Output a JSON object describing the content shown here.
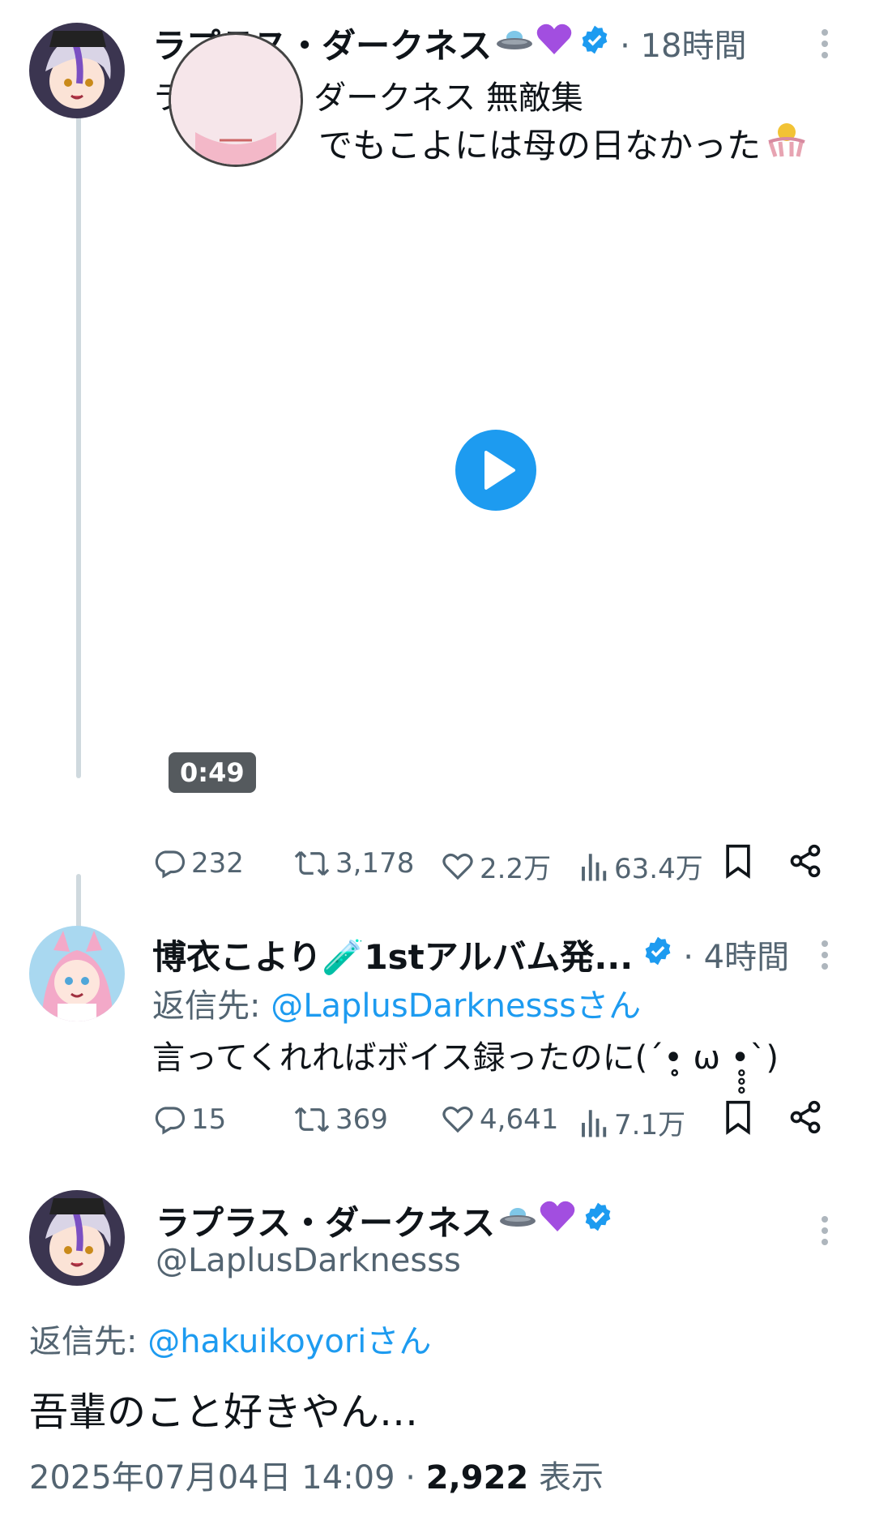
{
  "tweet1": {
    "display_name": "ラプラス・ダークネス",
    "name_emojis": [
      "ufo-icon",
      "purple-heart-icon"
    ],
    "time": "· 18時間",
    "quoted_title": "ラプラス・ダークネス 無敵集",
    "video_caption": "でもこよには母の日なかった",
    "video_duration": "0:49",
    "replies": "232",
    "retweets": "3,178",
    "likes": "2.2万",
    "views": "63.4万"
  },
  "tweet2": {
    "display_name": "博衣こより🧪1stアルバム発...",
    "time": "· 4時間",
    "reply_prefix": "返信先: ",
    "reply_to": "@LaplusDarknesssさん",
    "text": "言ってくれればボイス録ったのに(´•̥̥̥ ω •̥̥̥`)",
    "replies": "15",
    "retweets": "369",
    "likes": "4,641",
    "views": "7.1万"
  },
  "tweet3": {
    "display_name": "ラプラス・ダークネス",
    "handle": "@LaplusDarknesss",
    "reply_prefix": "返信先: ",
    "reply_to": "@hakuikoyoriさん",
    "text": "吾輩のこと好きやん…",
    "timestamp": "2025年07月04日 14:09 · ",
    "view_count": "2,922",
    "view_label": " 表示"
  },
  "colors": {
    "accent": "#1d9bf0",
    "muted": "#536471",
    "line": "#cfd9de"
  }
}
